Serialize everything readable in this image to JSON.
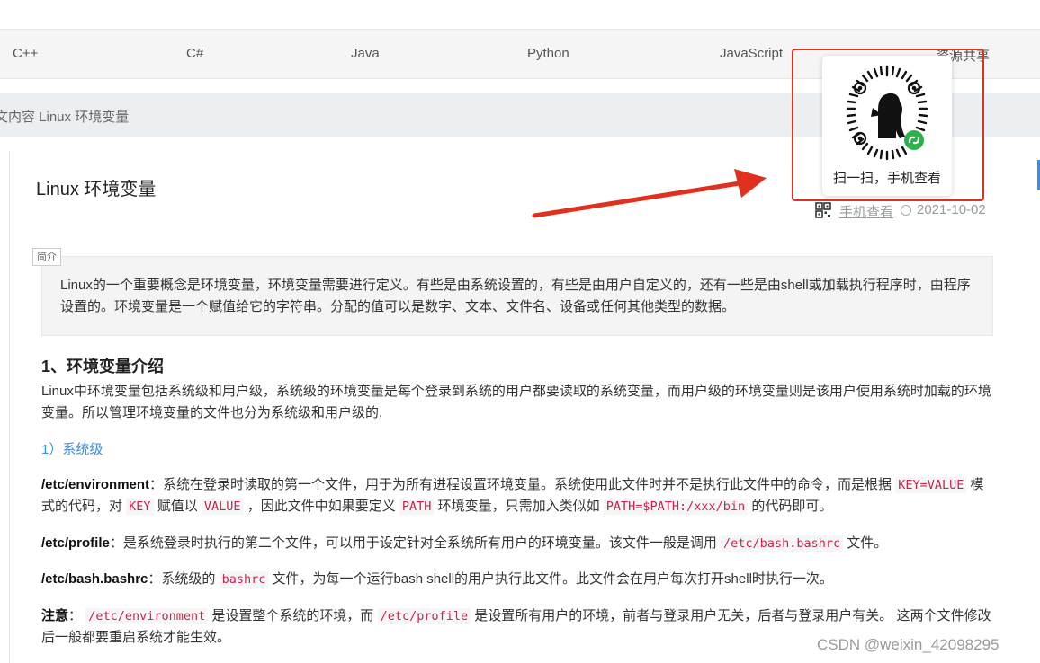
{
  "nav": {
    "items": [
      "C++",
      "C#",
      "Java",
      "Python",
      "JavaScript",
      "资源共享"
    ]
  },
  "breadcrumb": "文内容 Linux 环境变量",
  "article": {
    "title": "Linux 环境变量",
    "meta": {
      "mobile_link": "手机查看",
      "date": "2021-10-02"
    },
    "abstract_tag": "简介",
    "abstract": "Linux的一个重要概念是环境变量，环境变量需要进行定义。有些是由系统设置的，有些是由用户自定义的，还有一些是由shell或加载执行程序时，由程序设置的。环境变量是一个赋值给它的字符串。分配的值可以是数字、文本、文件名、设备或任何其他类型的数据。",
    "section1_heading": "1、环境变量介绍",
    "section1_intro": "Linux中环境变量包括系统级和用户级，系统级的环境变量是每个登录到系统的用户都要读取的系统变量，而用户级的环境变量则是该用户使用系统时加载的环境变量。所以管理环境变量的文件也分为系统级和用户级的.",
    "sub_heading": "1）系统级",
    "p_env": {
      "label": "/etc/environment",
      "t1": "：系统在登录时读取的第一个文件，用于为所有进程设置环境变量。系统使用此文件时并不是执行此文件中的命令，而是根据 ",
      "c1": "KEY=VALUE",
      "t2": " 模式的代码，对 ",
      "c2": "KEY",
      "t3": " 赋值以 ",
      "c3": "VALUE",
      "t4": " ，因此文件中如果要定义 ",
      "c4": "PATH",
      "t5": " 环境变量，只需加入类似如 ",
      "c5": "PATH=$PATH:/xxx/bin",
      "t6": " 的代码即可。"
    },
    "p_profile": {
      "label": "/etc/profile",
      "t1": "：是系统登录时执行的第二个文件，可以用于设定针对全系统所有用户的环境变量。该文件一般是调用 ",
      "c1": "/etc/bash.bashrc",
      "t2": " 文件。"
    },
    "p_bashrc": {
      "label": "/etc/bash.bashrc",
      "t1": "：系统级的 ",
      "c1": "bashrc",
      "t2": " 文件，为每一个运行bash shell的用户执行此文件。此文件会在用户每次打开shell时执行一次。"
    },
    "p_note": {
      "label": "注意",
      "t1": "： ",
      "c1": "/etc/environment",
      "t2": " 是设置整个系统的环境，而 ",
      "c2": "/etc/profile",
      "t3": " 是设置所有用户的环境，前者与登录用户无关，后者与登录用户有关。 这两个文件修改后一般都要重启系统才能生效。"
    }
  },
  "popup": {
    "caption": "扫一扫，手机查看"
  },
  "watermark": "CSDN @weixin_42098295",
  "colors": {
    "annotation_red": "#e0301e",
    "link_blue": "#3a8ee6",
    "code_red": "#c7254e",
    "wechat_green": "#2db14a"
  },
  "icons": [
    "qr-code-icon",
    "clock-icon",
    "wechat-mini-program-icon"
  ]
}
